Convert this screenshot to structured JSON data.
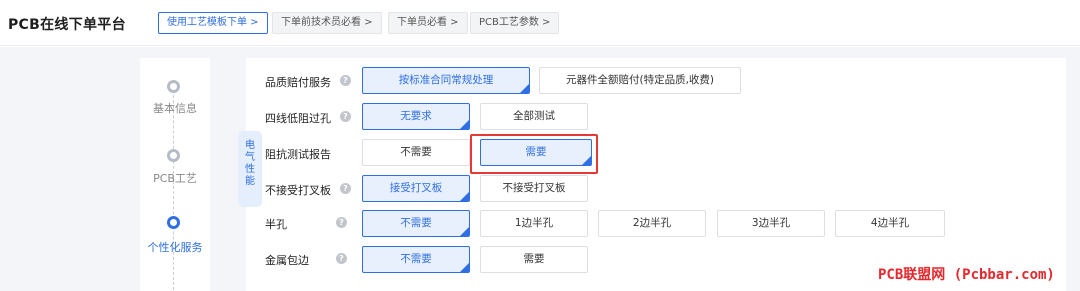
{
  "header": {
    "brand": "PCB在线下单平台",
    "breadcrumbs": [
      {
        "label": "使用工艺模板下单 >"
      },
      {
        "label": "下单前技术员必看 >"
      },
      {
        "label": "下单员必看 >"
      },
      {
        "label": "PCB工艺参数 >"
      }
    ]
  },
  "steps": [
    {
      "label": "基本信息"
    },
    {
      "label": "PCB工艺"
    },
    {
      "label": "个性化服务"
    }
  ],
  "section_tab": {
    "chars": [
      "电",
      "气",
      "性",
      "能"
    ]
  },
  "rows": [
    {
      "label": "品质赔付服务",
      "options": [
        {
          "label": "按标准合同常规处理",
          "selected": true
        },
        {
          "label": "元器件全额赔付(特定品质,收费)",
          "selected": false
        }
      ]
    },
    {
      "label": "四线低阻过孔",
      "options": [
        {
          "label": "无要求",
          "selected": true
        },
        {
          "label": "全部测试",
          "selected": false
        }
      ]
    },
    {
      "label": "阻抗测试报告",
      "options": [
        {
          "label": "不需要",
          "selected": false
        },
        {
          "label": "需要",
          "selected": true
        }
      ]
    },
    {
      "label": "不接受打叉板",
      "options": [
        {
          "label": "接受打叉板",
          "selected": true
        },
        {
          "label": "不接受打叉板",
          "selected": false
        }
      ]
    },
    {
      "label": "半孔",
      "options": [
        {
          "label": "不需要",
          "selected": true
        },
        {
          "label": "1边半孔",
          "selected": false
        },
        {
          "label": "2边半孔",
          "selected": false
        },
        {
          "label": "3边半孔",
          "selected": false
        },
        {
          "label": "4边半孔",
          "selected": false
        }
      ]
    },
    {
      "label": "金属包边",
      "options": [
        {
          "label": "不需要",
          "selected": true
        },
        {
          "label": "需要",
          "selected": false
        }
      ]
    }
  ],
  "help_glyph": "?",
  "watermark": "PCB联盟网 (Pcbbar.com)",
  "colors": {
    "accent": "#2f6fe3",
    "highlight": "#e53935",
    "watermark": "#e4282c"
  }
}
